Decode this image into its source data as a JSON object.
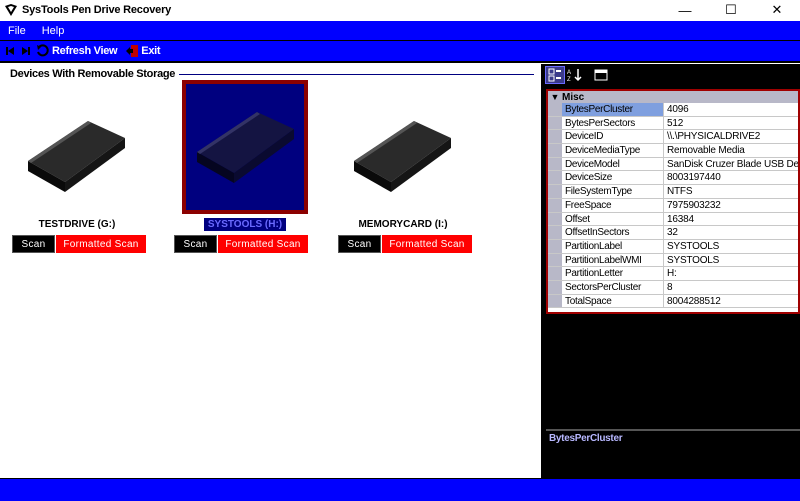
{
  "app": {
    "title": "SysTools Pen Drive Recovery"
  },
  "window_controls": {
    "minimize": "—",
    "maximize": "☐",
    "close": "✕"
  },
  "menu": {
    "items": [
      "File",
      "Help"
    ]
  },
  "toolbar": {
    "refresh_label": "Refresh View",
    "exit_label": "Exit"
  },
  "devices_panel": {
    "title": "Devices With Removable Storage",
    "devices": [
      {
        "label": "TESTDRIVE (G:)",
        "scan": "Scan",
        "formatted_scan": "Formatted Scan",
        "selected": false
      },
      {
        "label": "SYSTOOLS (H:)",
        "scan": "Scan",
        "formatted_scan": "Formatted Scan",
        "selected": true
      },
      {
        "label": "MEMORYCARD (I:)",
        "scan": "Scan",
        "formatted_scan": "Formatted Scan",
        "selected": false
      }
    ]
  },
  "properties": {
    "category": "Misc",
    "rows": [
      {
        "name": "BytesPerCluster",
        "value": "4096"
      },
      {
        "name": "BytesPerSectors",
        "value": "512"
      },
      {
        "name": "DeviceID",
        "value": "\\\\.\\PHYSICALDRIVE2"
      },
      {
        "name": "DeviceMediaType",
        "value": "Removable Media"
      },
      {
        "name": "DeviceModel",
        "value": "SanDisk Cruzer Blade USB Devi"
      },
      {
        "name": "DeviceSize",
        "value": "8003197440"
      },
      {
        "name": "FileSystemType",
        "value": "NTFS"
      },
      {
        "name": "FreeSpace",
        "value": "7975903232"
      },
      {
        "name": "Offset",
        "value": "16384"
      },
      {
        "name": "OffsetInSectors",
        "value": "32"
      },
      {
        "name": "PartitionLabel",
        "value": "SYSTOOLS"
      },
      {
        "name": "PartitionLabelWMI",
        "value": "SYSTOOLS"
      },
      {
        "name": "PartitionLetter",
        "value": "H:"
      },
      {
        "name": "SectorsPerCluster",
        "value": "8"
      },
      {
        "name": "TotalSpace",
        "value": "8004288512"
      }
    ],
    "description_title": "BytesPerCluster"
  }
}
